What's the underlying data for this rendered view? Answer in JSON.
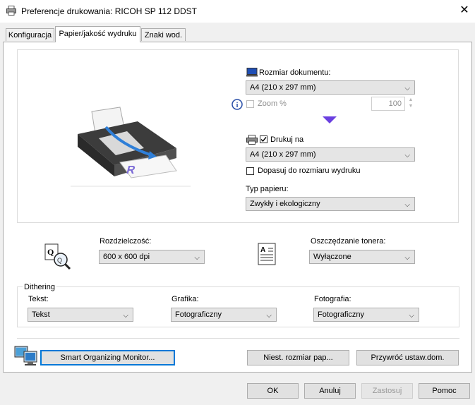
{
  "window": {
    "title": "Preferencje drukowania: RICOH SP 112 DDST",
    "close_glyph": "✕"
  },
  "tabs": [
    "Konfiguracja",
    "Papier/jakość wydruku",
    "Znaki wod."
  ],
  "paper": {
    "doc_size_label": "Rozmiar dokumentu:",
    "doc_size_value": "A4 (210 x 297 mm)",
    "zoom_label": "Zoom %",
    "zoom_value": "100",
    "print_on_label": "Drukuj na",
    "print_on_value": "A4 (210 x 297 mm)",
    "fit_label": "Dopasuj do rozmiaru wydruku",
    "paper_type_label": "Typ papieru:",
    "paper_type_value": "Zwykły i ekologiczny"
  },
  "quality": {
    "resolution_label": "Rozdzielczość:",
    "resolution_value": "600 x 600 dpi",
    "toner_label": "Oszczędzanie tonera:",
    "toner_value": "Wyłączone"
  },
  "dithering": {
    "title": "Dithering",
    "text_label": "Tekst:",
    "text_value": "Tekst",
    "graphics_label": "Grafika:",
    "graphics_value": "Fotograficzny",
    "photo_label": "Fotografia:",
    "photo_value": "Fotograficzny"
  },
  "bottom": {
    "smart_monitor": "Smart Organizing Monitor...",
    "custom_size": "Niest. rozmiar pap...",
    "restore_defaults": "Przywróć ustaw.dom."
  },
  "footer": {
    "ok": "OK",
    "cancel": "Anuluj",
    "apply": "Zastosuj",
    "help": "Pomoc"
  }
}
